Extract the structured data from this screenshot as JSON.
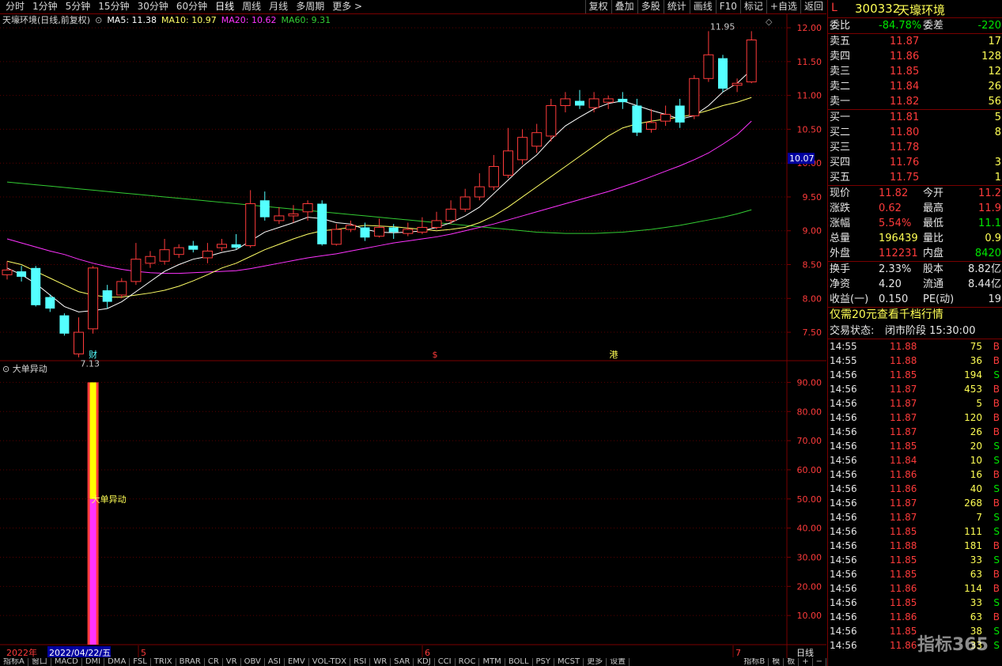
{
  "toolbar": {
    "periods": [
      "分时",
      "1分钟",
      "5分钟",
      "15分钟",
      "30分钟",
      "60分钟",
      "日线",
      "周线",
      "月线",
      "多周期",
      "更多 >"
    ],
    "active_period": "日线",
    "tools": [
      "复权",
      "叠加",
      "多股",
      "统计",
      "画线",
      "F10",
      "标记",
      "+自选",
      "返回"
    ]
  },
  "legend": {
    "title": "天壕环境(日线,前复权)",
    "ma5": "MA5: 11.38",
    "ma10": "MA10: 10.97",
    "ma20": "MA20: 10.62",
    "ma60": "MA60: 9.31",
    "colors": {
      "ma5": "#ffffff",
      "ma10": "#ffff66",
      "ma20": "#ff33ff",
      "ma60": "#33cc33"
    }
  },
  "chart_data": [
    {
      "type": "candlestick",
      "ylim": [
        7.15,
        12.2
      ],
      "yticks": [
        "12.00",
        "11.50",
        "11.00",
        "10.50",
        "10.00",
        "9.50",
        "9.00",
        "8.50",
        "8.00",
        "7.50"
      ],
      "current_price_label": "10.07",
      "high_label": "11.95",
      "low_label": "7.13",
      "candles": [
        {
          "o": 8.35,
          "c": 8.42,
          "h": 8.55,
          "l": 8.28
        },
        {
          "o": 8.4,
          "c": 8.32,
          "h": 8.48,
          "l": 8.25
        },
        {
          "o": 8.45,
          "c": 7.9,
          "h": 8.48,
          "l": 7.88
        },
        {
          "o": 8.02,
          "c": 7.85,
          "h": 8.06,
          "l": 7.8
        },
        {
          "o": 7.75,
          "c": 7.48,
          "h": 7.78,
          "l": 7.45
        },
        {
          "o": 7.18,
          "c": 7.5,
          "h": 7.72,
          "l": 7.13
        },
        {
          "o": 7.55,
          "c": 8.45,
          "h": 8.48,
          "l": 7.48
        },
        {
          "o": 8.12,
          "c": 7.95,
          "h": 8.2,
          "l": 7.85
        },
        {
          "o": 8.05,
          "c": 8.25,
          "h": 8.3,
          "l": 8.0
        },
        {
          "o": 8.25,
          "c": 8.58,
          "h": 8.82,
          "l": 8.2
        },
        {
          "o": 8.52,
          "c": 8.62,
          "h": 8.7,
          "l": 8.45
        },
        {
          "o": 8.55,
          "c": 8.72,
          "h": 8.88,
          "l": 8.5
        },
        {
          "o": 8.65,
          "c": 8.75,
          "h": 8.8,
          "l": 8.6
        },
        {
          "o": 8.78,
          "c": 8.72,
          "h": 8.85,
          "l": 8.68
        },
        {
          "o": 8.6,
          "c": 8.7,
          "h": 8.82,
          "l": 8.52
        },
        {
          "o": 8.75,
          "c": 8.8,
          "h": 8.88,
          "l": 8.7
        },
        {
          "o": 8.8,
          "c": 8.75,
          "h": 8.95,
          "l": 8.72
        },
        {
          "o": 8.78,
          "c": 9.4,
          "h": 9.6,
          "l": 8.75
        },
        {
          "o": 9.45,
          "c": 9.2,
          "h": 9.58,
          "l": 9.15
        },
        {
          "o": 9.15,
          "c": 9.22,
          "h": 9.35,
          "l": 9.1
        },
        {
          "o": 9.22,
          "c": 9.25,
          "h": 9.38,
          "l": 9.12
        },
        {
          "o": 9.28,
          "c": 9.4,
          "h": 9.45,
          "l": 9.15
        },
        {
          "o": 9.4,
          "c": 8.8,
          "h": 9.45,
          "l": 8.78
        },
        {
          "o": 8.8,
          "c": 9.02,
          "h": 9.1,
          "l": 8.78
        },
        {
          "o": 9.02,
          "c": 9.08,
          "h": 9.15,
          "l": 8.98
        },
        {
          "o": 9.05,
          "c": 8.9,
          "h": 9.12,
          "l": 8.85
        },
        {
          "o": 8.92,
          "c": 9.05,
          "h": 9.18,
          "l": 8.9
        },
        {
          "o": 9.05,
          "c": 8.98,
          "h": 9.1,
          "l": 8.88
        },
        {
          "o": 8.96,
          "c": 9.02,
          "h": 9.12,
          "l": 8.92
        },
        {
          "o": 8.98,
          "c": 9.05,
          "h": 9.2,
          "l": 8.95
        },
        {
          "o": 9.05,
          "c": 9.15,
          "h": 9.28,
          "l": 9.02
        },
        {
          "o": 9.15,
          "c": 9.32,
          "h": 9.45,
          "l": 9.1
        },
        {
          "o": 9.32,
          "c": 9.5,
          "h": 9.62,
          "l": 9.28
        },
        {
          "o": 9.5,
          "c": 9.65,
          "h": 9.85,
          "l": 9.45
        },
        {
          "o": 9.65,
          "c": 9.95,
          "h": 10.12,
          "l": 9.6
        },
        {
          "o": 9.82,
          "c": 10.18,
          "h": 10.52,
          "l": 9.78
        },
        {
          "o": 10.05,
          "c": 10.38,
          "h": 10.5,
          "l": 9.98
        },
        {
          "o": 10.25,
          "c": 10.45,
          "h": 10.58,
          "l": 10.15
        },
        {
          "o": 10.4,
          "c": 10.85,
          "h": 10.95,
          "l": 10.32
        },
        {
          "o": 10.85,
          "c": 10.95,
          "h": 11.05,
          "l": 10.75
        },
        {
          "o": 10.92,
          "c": 10.85,
          "h": 11.08,
          "l": 10.8
        },
        {
          "o": 10.82,
          "c": 10.95,
          "h": 11.05,
          "l": 10.75
        },
        {
          "o": 10.9,
          "c": 10.95,
          "h": 11.0,
          "l": 10.8
        },
        {
          "o": 10.95,
          "c": 10.9,
          "h": 11.05,
          "l": 10.8
        },
        {
          "o": 10.85,
          "c": 10.45,
          "h": 10.95,
          "l": 10.4
        },
        {
          "o": 10.5,
          "c": 10.6,
          "h": 10.8,
          "l": 10.45
        },
        {
          "o": 10.62,
          "c": 10.72,
          "h": 10.85,
          "l": 10.55
        },
        {
          "o": 10.85,
          "c": 10.6,
          "h": 10.95,
          "l": 10.52
        },
        {
          "o": 10.7,
          "c": 11.25,
          "h": 11.3,
          "l": 10.65
        },
        {
          "o": 11.25,
          "c": 11.6,
          "h": 11.95,
          "l": 11.2
        },
        {
          "o": 11.55,
          "c": 11.1,
          "h": 11.6,
          "l": 11.05
        },
        {
          "o": 11.15,
          "c": 11.18,
          "h": 11.25,
          "l": 11.05
        },
        {
          "o": 11.2,
          "c": 11.82,
          "h": 11.95,
          "l": 11.18
        }
      ],
      "ma5": [
        8.45,
        8.35,
        8.22,
        8.05,
        7.88,
        7.8,
        7.82,
        7.85,
        7.95,
        8.1,
        8.25,
        8.4,
        8.5,
        8.58,
        8.62,
        8.68,
        8.72,
        8.85,
        8.98,
        9.05,
        9.12,
        9.2,
        9.18,
        9.12,
        9.1,
        9.02,
        8.98,
        8.97,
        8.98,
        9.0,
        9.05,
        9.12,
        9.22,
        9.35,
        9.55,
        9.75,
        9.95,
        10.12,
        10.35,
        10.55,
        10.68,
        10.8,
        10.88,
        10.92,
        10.85,
        10.78,
        10.72,
        10.65,
        10.7,
        10.85,
        11.05,
        11.18,
        11.38
      ],
      "ma10": [
        8.55,
        8.5,
        8.4,
        8.3,
        8.2,
        8.1,
        8.05,
        8.02,
        8.02,
        8.05,
        8.08,
        8.12,
        8.18,
        8.26,
        8.35,
        8.45,
        8.52,
        8.62,
        8.72,
        8.8,
        8.88,
        8.95,
        9.0,
        9.02,
        9.05,
        9.08,
        9.07,
        9.06,
        9.04,
        9.02,
        9.0,
        9.02,
        9.05,
        9.12,
        9.22,
        9.35,
        9.5,
        9.65,
        9.8,
        9.95,
        10.1,
        10.25,
        10.4,
        10.52,
        10.58,
        10.62,
        10.65,
        10.68,
        10.72,
        10.78,
        10.85,
        10.9,
        10.97
      ],
      "ma20": [
        8.88,
        8.82,
        8.76,
        8.7,
        8.65,
        8.58,
        8.52,
        8.47,
        8.43,
        8.4,
        8.38,
        8.37,
        8.37,
        8.38,
        8.39,
        8.4,
        8.41,
        8.44,
        8.48,
        8.52,
        8.56,
        8.6,
        8.63,
        8.66,
        8.7,
        8.74,
        8.78,
        8.82,
        8.85,
        8.88,
        8.91,
        8.95,
        9.0,
        9.05,
        9.1,
        9.16,
        9.22,
        9.28,
        9.34,
        9.4,
        9.46,
        9.52,
        9.58,
        9.65,
        9.72,
        9.8,
        9.88,
        9.96,
        10.05,
        10.15,
        10.28,
        10.42,
        10.62
      ],
      "ma60": [
        9.72,
        9.7,
        9.68,
        9.66,
        9.64,
        9.62,
        9.6,
        9.58,
        9.56,
        9.54,
        9.52,
        9.5,
        9.48,
        9.46,
        9.44,
        9.42,
        9.4,
        9.38,
        9.36,
        9.34,
        9.32,
        9.3,
        9.28,
        9.26,
        9.24,
        9.22,
        9.2,
        9.18,
        9.16,
        9.14,
        9.12,
        9.1,
        9.08,
        9.06,
        9.04,
        9.02,
        9.0,
        8.98,
        8.97,
        8.96,
        8.96,
        8.96,
        8.97,
        8.98,
        9.0,
        9.02,
        9.05,
        9.08,
        9.12,
        9.16,
        9.2,
        9.25,
        9.31
      ]
    },
    {
      "type": "bar",
      "title": "大单异动",
      "ylim": [
        0,
        95
      ],
      "yticks": [
        "90.00",
        "80.00",
        "70.00",
        "60.00",
        "50.00",
        "40.00",
        "30.00",
        "20.00",
        "10.00"
      ],
      "bar_index": 6,
      "bar_label": "大单异动",
      "segments": [
        {
          "from": 0,
          "to": 50,
          "color": "#ff33ff"
        },
        {
          "from": 50,
          "to": 90,
          "color": "#ffff00"
        }
      ]
    }
  ],
  "markers": {
    "cai": "财",
    "s": "$",
    "gang": "港"
  },
  "xaxis": {
    "year": "2022年",
    "cursor_date": "2022/04/22/五",
    "ticks": [
      "5",
      "6",
      "7"
    ],
    "right_label": "日线"
  },
  "bottom_tabs": [
    "指标A",
    "窗口",
    "MACD",
    "DMI",
    "DMA",
    "FSL",
    "TRIX",
    "BRAR",
    "CR",
    "VR",
    "OBV",
    "ASI",
    "EMV",
    "VOL-TDX",
    "RSI",
    "WR",
    "SAR",
    "KDJ",
    "CCI",
    "ROC",
    "MTM",
    "BOLL",
    "PSY",
    "MCST",
    "更多",
    "设置"
  ],
  "bottom_right": [
    "指标B",
    "模",
    "板",
    "+",
    "−"
  ],
  "quote": {
    "flag": "L",
    "code": "300332",
    "name": "天壕环境",
    "weibi_label": "委比",
    "weibi_value": "-84.78%",
    "weicha_label": "委差",
    "weicha_value": "-220",
    "asks": [
      {
        "label": "卖五",
        "price": "11.87",
        "vol": "17"
      },
      {
        "label": "卖四",
        "price": "11.86",
        "vol": "128"
      },
      {
        "label": "卖三",
        "price": "11.85",
        "vol": "12"
      },
      {
        "label": "卖二",
        "price": "11.84",
        "vol": "26"
      },
      {
        "label": "卖一",
        "price": "11.82",
        "vol": "56"
      }
    ],
    "bids": [
      {
        "label": "买一",
        "price": "11.81",
        "vol": "5"
      },
      {
        "label": "买二",
        "price": "11.80",
        "vol": "8"
      },
      {
        "label": "买三",
        "price": "11.78",
        "vol": ""
      },
      {
        "label": "买四",
        "price": "11.76",
        "vol": "3"
      },
      {
        "label": "买五",
        "price": "11.75",
        "vol": "1"
      }
    ],
    "stats": [
      {
        "l1": "现价",
        "v1": "11.82",
        "c1": "red",
        "l2": "今开",
        "v2": "11.2",
        "c2": "red"
      },
      {
        "l1": "涨跌",
        "v1": "0.62",
        "c1": "red",
        "l2": "最高",
        "v2": "11.9",
        "c2": "red"
      },
      {
        "l1": "涨幅",
        "v1": "5.54%",
        "c1": "red",
        "l2": "最低",
        "v2": "11.1",
        "c2": "green"
      },
      {
        "l1": "总量",
        "v1": "196439",
        "c1": "yellow",
        "l2": "量比",
        "v2": "0.9",
        "c2": "yellow"
      },
      {
        "l1": "外盘",
        "v1": "112231",
        "c1": "red",
        "l2": "内盘",
        "v2": "8420",
        "c2": "green"
      }
    ],
    "stats2": [
      {
        "l1": "换手",
        "v1": "2.33%",
        "l2": "股本",
        "v2": "8.82亿"
      },
      {
        "l1": "净资",
        "v1": "4.20",
        "l2": "流通",
        "v2": "8.44亿"
      },
      {
        "l1": "收益(一)",
        "v1": "0.150",
        "l2": "PE(动)",
        "v2": "19"
      }
    ],
    "promo": "仅需20元查看千档行情",
    "status_label": "交易状态:",
    "status_value": "闭市阶段 15:30:00"
  },
  "ticks": [
    {
      "t": "14:55",
      "p": "11.88",
      "v": "75",
      "s": "B"
    },
    {
      "t": "14:55",
      "p": "11.88",
      "v": "36",
      "s": "B"
    },
    {
      "t": "14:56",
      "p": "11.85",
      "v": "194",
      "s": "S"
    },
    {
      "t": "14:56",
      "p": "11.87",
      "v": "453",
      "s": "B"
    },
    {
      "t": "14:56",
      "p": "11.87",
      "v": "5",
      "s": "B"
    },
    {
      "t": "14:56",
      "p": "11.87",
      "v": "120",
      "s": "B"
    },
    {
      "t": "14:56",
      "p": "11.87",
      "v": "26",
      "s": "B"
    },
    {
      "t": "14:56",
      "p": "11.85",
      "v": "20",
      "s": "S"
    },
    {
      "t": "14:56",
      "p": "11.84",
      "v": "10",
      "s": "S"
    },
    {
      "t": "14:56",
      "p": "11.86",
      "v": "16",
      "s": "B"
    },
    {
      "t": "14:56",
      "p": "11.86",
      "v": "40",
      "s": "S"
    },
    {
      "t": "14:56",
      "p": "11.87",
      "v": "268",
      "s": "B"
    },
    {
      "t": "14:56",
      "p": "11.87",
      "v": "7",
      "s": "S"
    },
    {
      "t": "14:56",
      "p": "11.85",
      "v": "111",
      "s": "S"
    },
    {
      "t": "14:56",
      "p": "11.88",
      "v": "181",
      "s": "B"
    },
    {
      "t": "14:56",
      "p": "11.85",
      "v": "33",
      "s": "S"
    },
    {
      "t": "14:56",
      "p": "11.85",
      "v": "63",
      "s": "B"
    },
    {
      "t": "14:56",
      "p": "11.86",
      "v": "114",
      "s": "B"
    },
    {
      "t": "14:56",
      "p": "11.85",
      "v": "33",
      "s": "S"
    },
    {
      "t": "14:56",
      "p": "11.86",
      "v": "63",
      "s": "B"
    },
    {
      "t": "14:56",
      "p": "11.85",
      "v": "38",
      "s": "S"
    },
    {
      "t": "14:56",
      "p": "11.86",
      "v": "33",
      "s": "S"
    }
  ],
  "watermark": "指标365"
}
